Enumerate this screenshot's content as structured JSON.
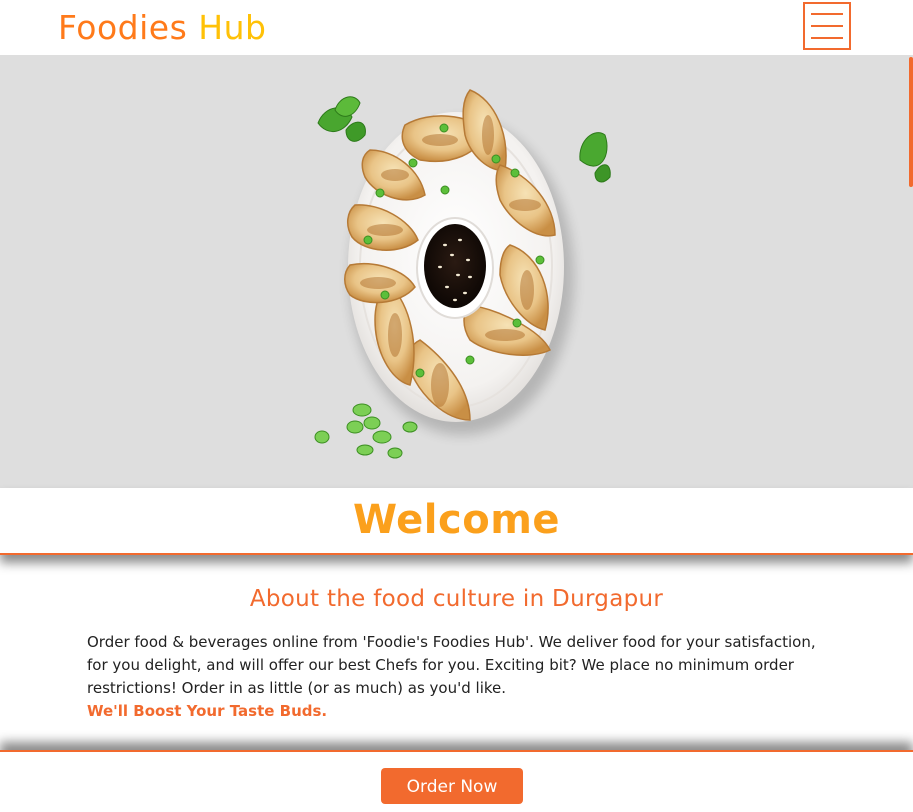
{
  "header": {
    "brand_word1": "Foodies",
    "brand_word2": "Hub",
    "menu_icon": "hamburger-menu-icon"
  },
  "hero": {
    "image": "plate of pan-fried dumplings with soy dipping sauce, mint leaves and spring onions"
  },
  "welcome": {
    "title": "Welcome"
  },
  "about": {
    "title": "About the food culture in Durgapur",
    "text": "Order food & beverages online from 'Foodie's Foodies Hub'. We deliver food for your satisfaction, for you delight, and will offer our best Chefs for you. Exciting bit? We place no minimum order restrictions! Order in as little (or as much) as you'd like.",
    "highlight": "We'll Boost Your Taste Buds."
  },
  "cta": {
    "order_label": "Order Now"
  },
  "colors": {
    "accent": "#f26a2e",
    "brand_orange": "#ff7a1a",
    "brand_yellow": "#ffc107",
    "welcome": "#fba01c",
    "hero_bg": "#dedede"
  }
}
